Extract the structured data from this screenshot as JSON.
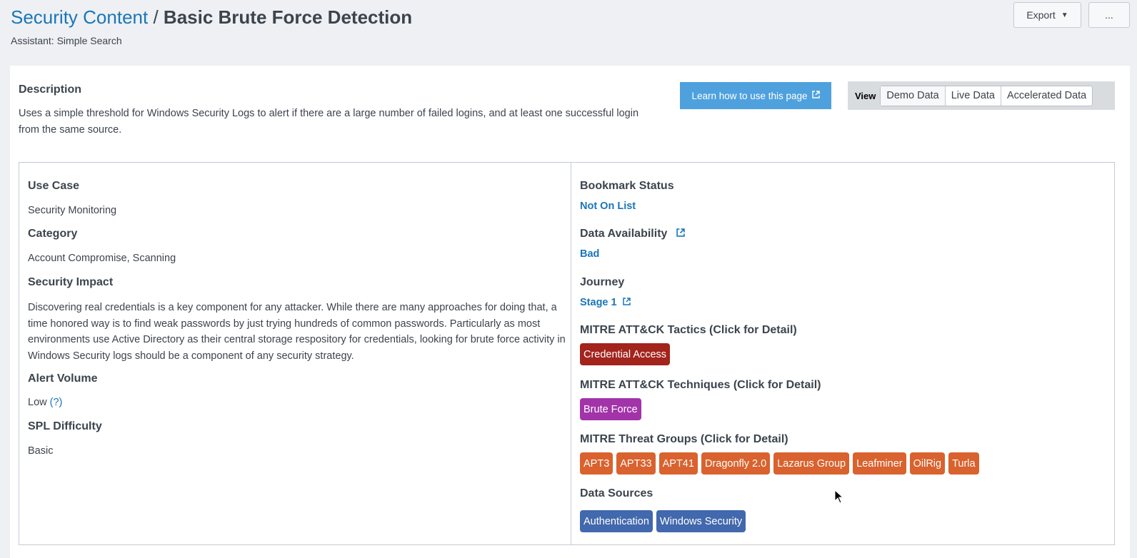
{
  "header": {
    "breadcrumb": "Security Content",
    "separator": "/",
    "title": "Basic Brute Force Detection",
    "subtitle": "Assistant: Simple Search",
    "export_label": "Export",
    "export_icon": "caret-down-icon",
    "more_label": "..."
  },
  "description": {
    "heading": "Description",
    "text": "Uses a simple threshold for Windows Security Logs to alert if there are a large number of failed logins, and at least one successful login from the same source."
  },
  "learn_button": {
    "label": "Learn how to use this page",
    "icon": "external-link-icon"
  },
  "view": {
    "label": "View",
    "options": [
      "Demo Data",
      "Live Data",
      "Accelerated Data"
    ],
    "selected": "Demo Data"
  },
  "left": {
    "use_case": {
      "label": "Use Case",
      "value": "Security Monitoring"
    },
    "category": {
      "label": "Category",
      "value": "Account Compromise, Scanning"
    },
    "security_impact": {
      "label": "Security Impact",
      "value": "Discovering real credentials is a key component for any attacker. While there are many approaches for doing that, a time honored way is to find weak passwords by just trying hundreds of common passwords. Particularly as most environments use Active Directory as their central storage respository for credentials, looking for brute force activity in Windows Security logs should be a component of any security strategy."
    },
    "alert_volume": {
      "label": "Alert Volume",
      "value": "Low",
      "help": "(?)"
    },
    "spl_difficulty": {
      "label": "SPL Difficulty",
      "value": "Basic"
    }
  },
  "right": {
    "bookmark": {
      "label": "Bookmark Status",
      "value": "Not On List"
    },
    "availability": {
      "label": "Data Availability",
      "value": "Bad"
    },
    "journey": {
      "label": "Journey",
      "value": "Stage 1"
    },
    "tactics": {
      "label": "MITRE ATT&CK Tactics (Click for Detail)",
      "items": [
        "Credential Access"
      ],
      "color": "#a2241c"
    },
    "techniques": {
      "label": "MITRE ATT&CK Techniques (Click for Detail)",
      "items": [
        "Brute Force"
      ],
      "color": "#a233a9"
    },
    "threat_groups": {
      "label": "MITRE Threat Groups (Click for Detail)",
      "items": [
        "APT3",
        "APT33",
        "APT41",
        "Dragonfly 2.0",
        "Lazarus Group",
        "Leafminer",
        "OilRig",
        "Turla"
      ],
      "color": "#d9622e"
    },
    "data_sources": {
      "label": "Data Sources",
      "items": [
        "Authentication",
        "Windows Security"
      ],
      "color": "#4268ad"
    }
  },
  "colors": {
    "link": "#1a76b8",
    "learn_button": "#4fa1de"
  }
}
